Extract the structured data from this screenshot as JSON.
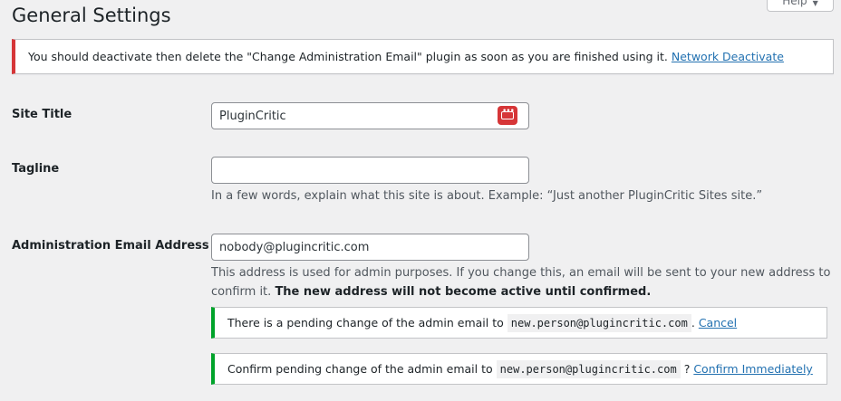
{
  "page": {
    "title": "General Settings",
    "help_label": "Help"
  },
  "notice": {
    "message": "You should deactivate then delete the \"Change Administration Email\" plugin as soon as you are finished using it.",
    "link_label": "Network Deactivate"
  },
  "site_title": {
    "label": "Site Title",
    "value": "PluginCritic",
    "icon": "password-manager-icon",
    "icon_color": "#d63638"
  },
  "tagline": {
    "label": "Tagline",
    "value": "",
    "description": "In a few words, explain what this site is about. Example: “Just another PluginCritic Sites site.”"
  },
  "admin_email": {
    "label": "Administration Email Address",
    "value": "nobody@plugincritic.com",
    "description_line1": "This address is used for admin purposes. If you change this, an email will be sent to your new address to",
    "description_line2": "confirm it.",
    "description_strong": "The new address will not become active until confirmed.",
    "pending": {
      "text": "There is a pending change of the admin email to",
      "email": "new.person@plugincritic.com",
      "separator": ".",
      "cancel_label": "Cancel"
    },
    "confirm": {
      "text": "Confirm pending change of the admin email to",
      "email": "new.person@plugincritic.com",
      "separator": "?",
      "confirm_label": "Confirm Immediately"
    }
  },
  "colors": {
    "error_border": "#d63638",
    "success_border": "#00a32a",
    "link": "#2271b1",
    "background": "#f0f0f1"
  }
}
